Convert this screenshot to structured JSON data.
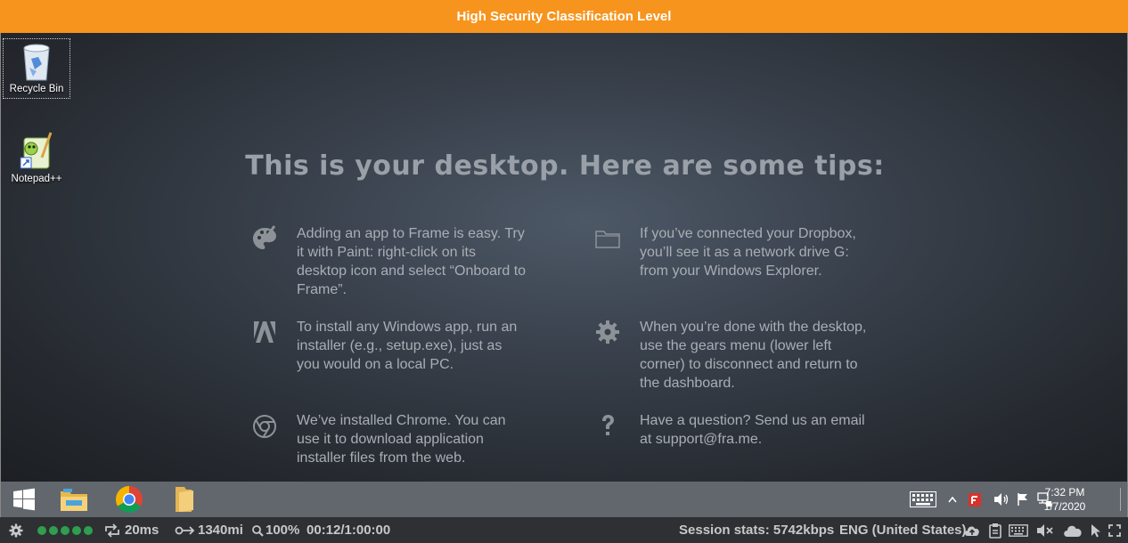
{
  "banner": {
    "text": "High Security Classification Level"
  },
  "desktop_icons": [
    {
      "label": "Recycle Bin",
      "icon": "recycle-bin-icon"
    },
    {
      "label": "Notepad++",
      "icon": "notepad-plus-plus-icon"
    }
  ],
  "tips": {
    "title": "This is your desktop. Here are some tips:",
    "items": [
      {
        "icon": "palette-icon",
        "text": "Adding an app to Frame is easy. Try it with Paint: right-click on its desktop icon and select “Onboard to Frame”."
      },
      {
        "icon": "folder-icon",
        "text": "If you’ve connected your Dropbox, you’ll see it as a network drive G: from your Windows Explorer."
      },
      {
        "icon": "installer-icon",
        "text": "To install any Windows app, run an installer (e.g., setup.exe), just as you would on a local PC."
      },
      {
        "icon": "gear-icon",
        "text": "When you’re done with the desktop, use the gears menu (lower left corner) to disconnect and return to the dashboard."
      },
      {
        "icon": "chrome-icon",
        "text": "We’ve installed Chrome. You can use it to download application installer files from the web."
      },
      {
        "icon": "question-icon",
        "text": "Have a question? Send us an email at support@fra.me."
      }
    ]
  },
  "taskbar": {
    "clock_time": "7:32 PM",
    "clock_date": "1/7/2020"
  },
  "statusbar": {
    "latency": "20ms",
    "distance": "1340mi",
    "zoom": "100%",
    "session_time": "00:12/1:00:00",
    "session_stats": "Session stats: 5742kbps",
    "language": "ENG (United States)"
  },
  "colors": {
    "banner": "#f7941d",
    "status_dots": "#2f9e4f",
    "taskbar": "#62676d"
  }
}
